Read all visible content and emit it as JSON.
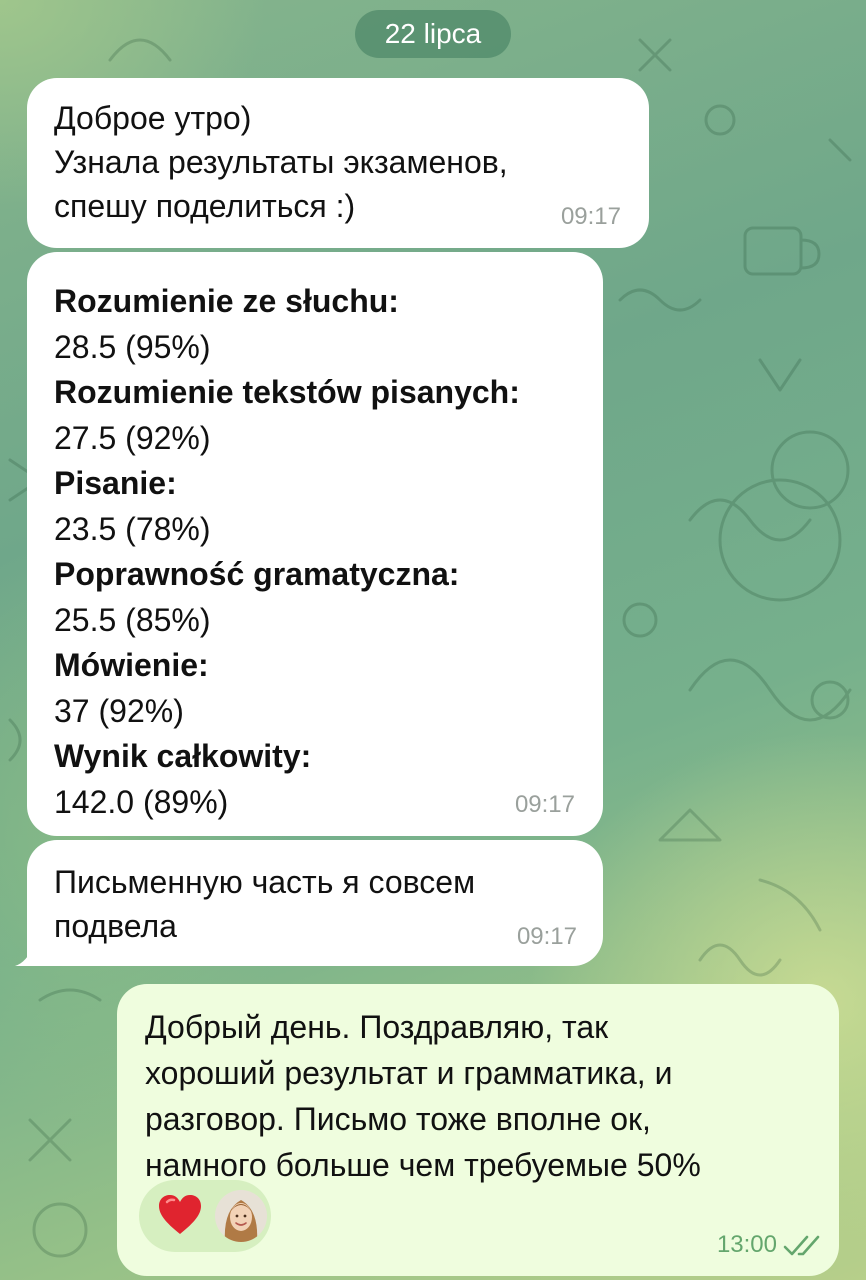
{
  "date_separator": "22 lipca",
  "messages": [
    {
      "lines": "Доброе утро)\nУзнала результаты экзаменов,\nспешу поделиться :)",
      "time": "09:17"
    },
    {
      "results": [
        {
          "label": "Rozumienie ze słuchu:",
          "value": "28.5 (95%)"
        },
        {
          "label": "Rozumienie tekstów pisanych:",
          "value": "27.5 (92%)"
        },
        {
          "label": "Pisanie:",
          "value": "23.5 (78%)"
        },
        {
          "label": "Poprawność gramatyczna:",
          "value": "25.5 (85%)"
        },
        {
          "label": "Mówienie:",
          "value": "37 (92%)"
        },
        {
          "label": "Wynik całkowity:",
          "value": "142.0 (89%)"
        }
      ],
      "time": "09:17"
    },
    {
      "lines": "Письменную часть я совсем\nподвела",
      "time": "09:17"
    }
  ],
  "reply": {
    "lines": "Добрый день. Поздравляю, так\nхороший результат и грамматика, и\nразговор. Письмо тоже вполне ок,\nнамного больше чем требуемые 50%",
    "time": "13:00",
    "status_icon": "double-check-icon",
    "reaction": {
      "emoji_icon": "red-heart-icon",
      "reactor": "avatar"
    }
  },
  "colors": {
    "incoming_bubble": "#ffffff",
    "outgoing_bubble": "#effdde",
    "outgoing_time": "#64a66d",
    "reaction_pill": "#d6efc0",
    "heart": "#e0242f"
  }
}
